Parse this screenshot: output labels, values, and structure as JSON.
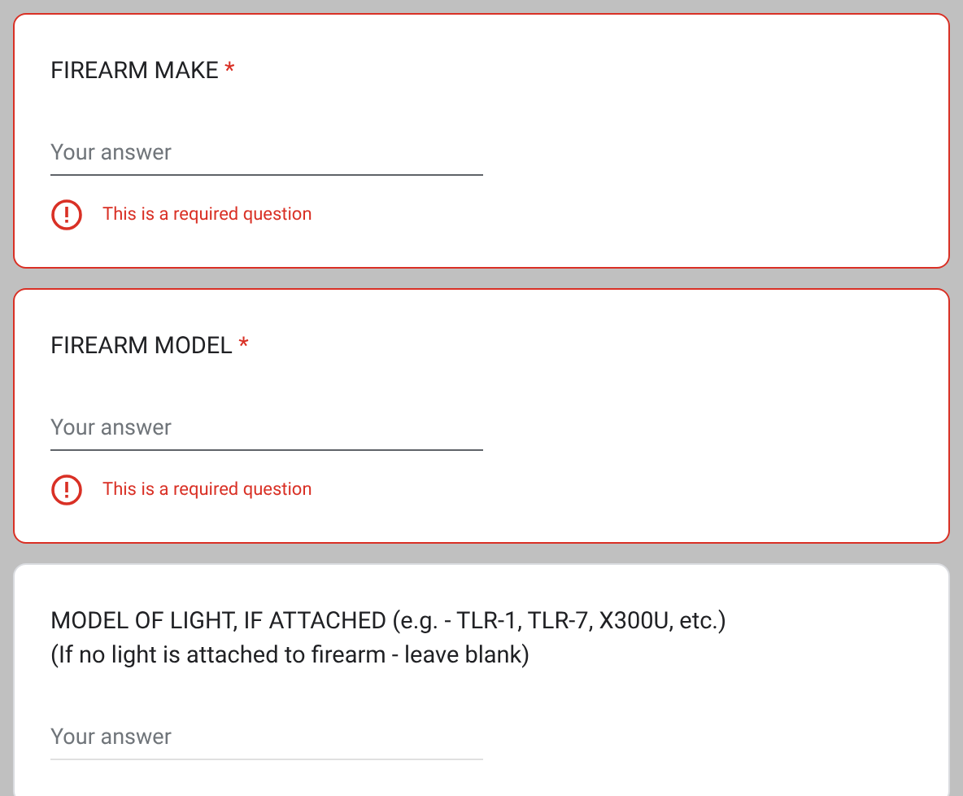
{
  "questions": [
    {
      "title": "FIREARM MAKE",
      "required_mark": "*",
      "placeholder": "Your answer",
      "error": "This is a required question"
    },
    {
      "title": "FIREARM MODEL",
      "required_mark": "*",
      "placeholder": "Your answer",
      "error": "This is a required question"
    },
    {
      "title": "MODEL OF LIGHT, IF ATTACHED (e.g. - TLR-1, TLR-7, X300U, etc.)",
      "subtitle": "(If no light is attached to firearm - leave blank)",
      "placeholder": "Your answer"
    }
  ]
}
